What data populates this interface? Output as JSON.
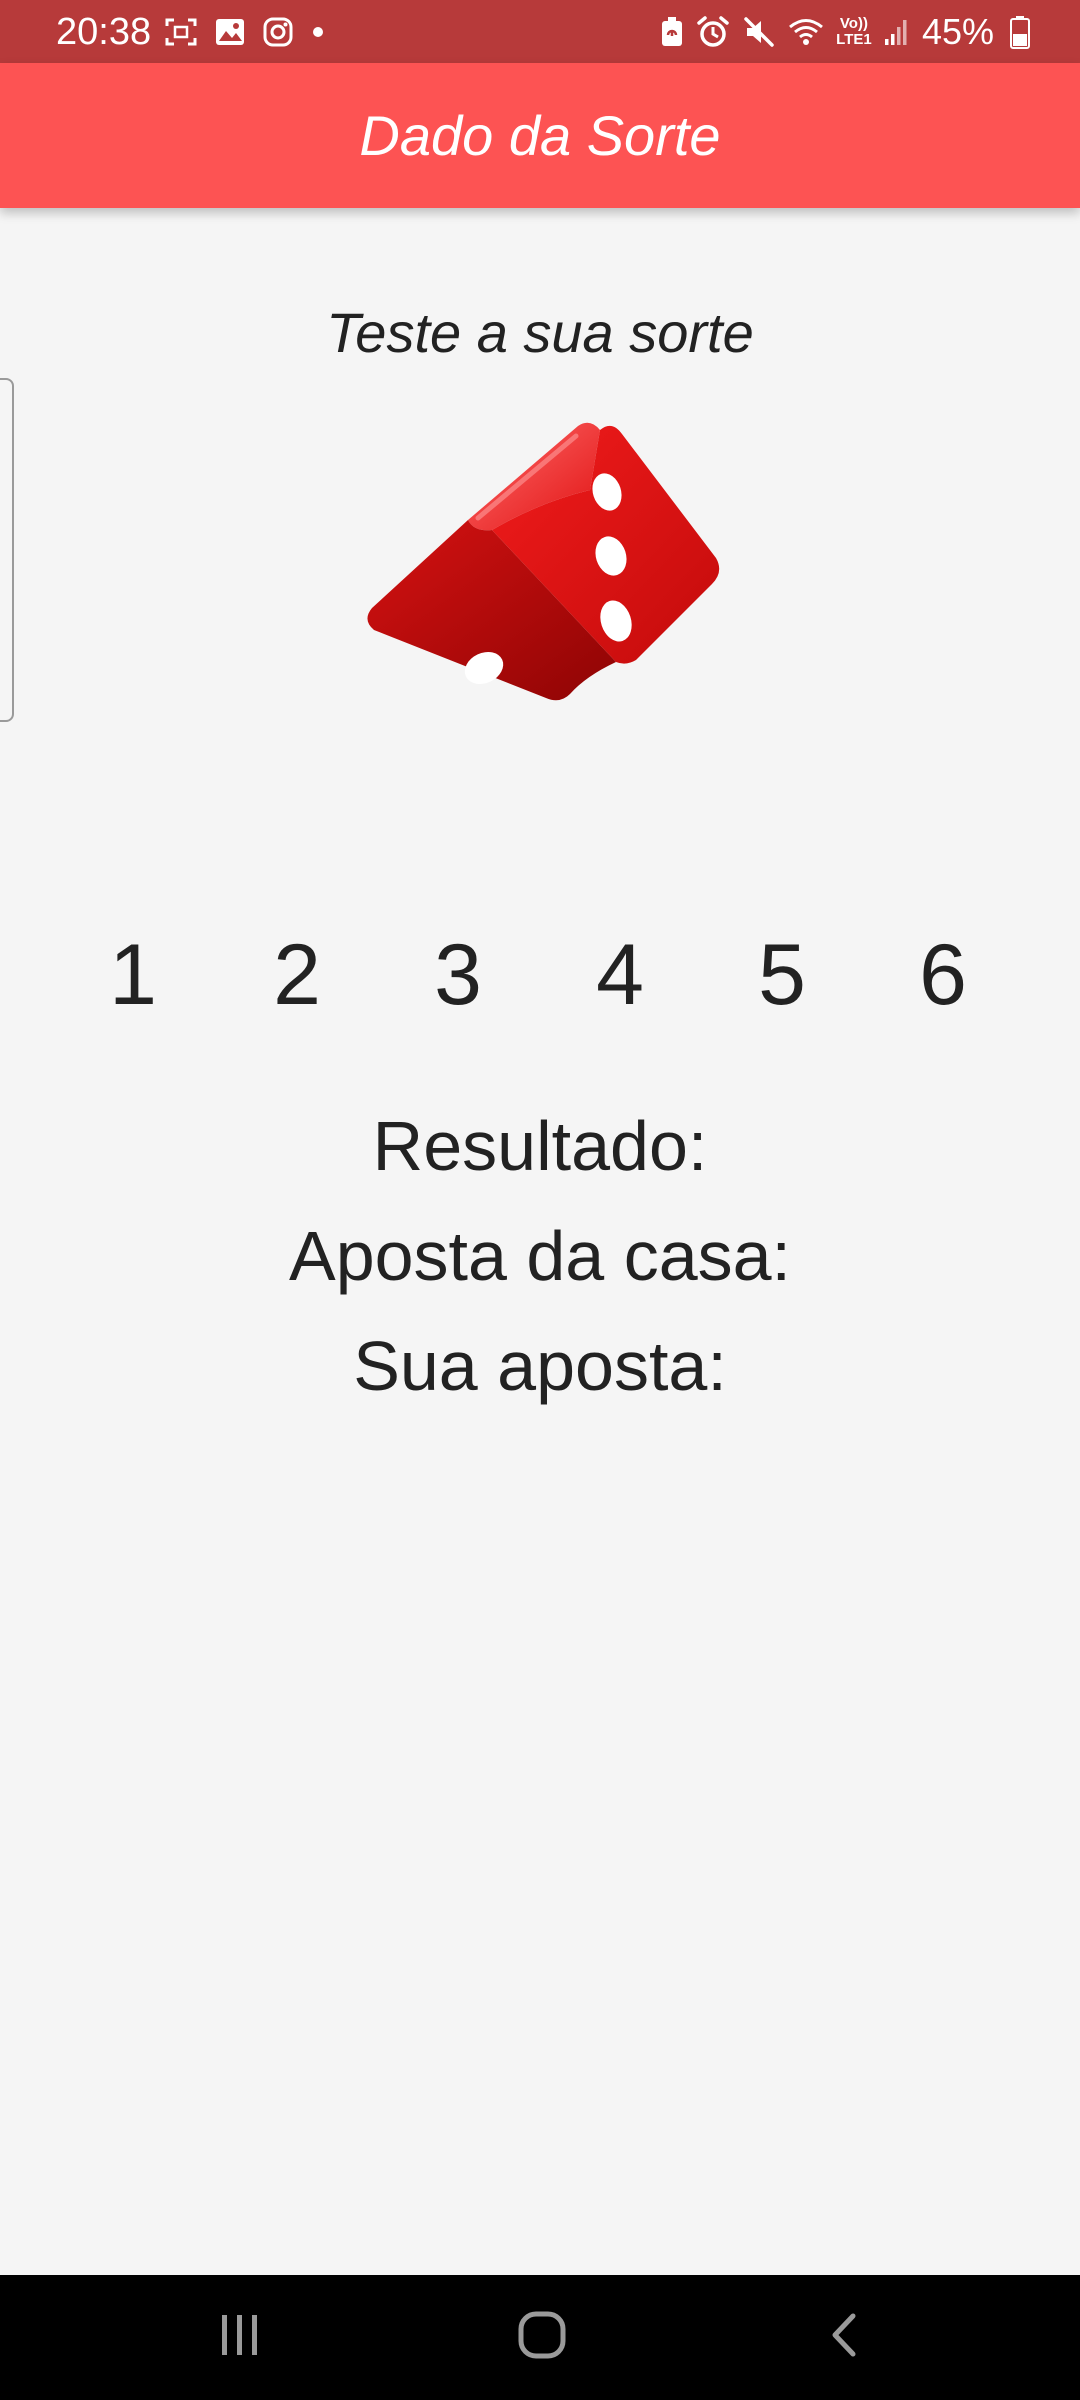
{
  "status_bar": {
    "time": "20:38",
    "battery": "45%",
    "network": "LTE1",
    "volte": "Vo))",
    "left_icons": [
      "screenshot-icon",
      "gallery-icon",
      "instagram-icon",
      "notification-dot-icon"
    ],
    "right_icons": [
      "battery-saver-icon",
      "alarm-icon",
      "mute-icon",
      "wifi-icon",
      "volte-lte-icon",
      "signal-icon",
      "battery-icon"
    ]
  },
  "app_bar": {
    "title": "Dado da Sorte"
  },
  "main": {
    "subtitle": "Teste a sua sorte",
    "dice_icon": "dice-icon",
    "bet_numbers": [
      "1",
      "2",
      "3",
      "4",
      "5",
      "6"
    ],
    "result_label": "Resultado:",
    "house_bet_label": "Aposta da casa:",
    "your_bet_label": "Sua aposta:"
  },
  "nav_bar": {
    "buttons": [
      "recent-apps-icon",
      "home-icon",
      "back-icon"
    ]
  },
  "colors": {
    "status_bar": "#b73a3a",
    "app_bar": "#fd5353",
    "background": "#f5f5f5",
    "text": "#222222",
    "dice_red": "#e81515",
    "nav_bar": "#000000"
  }
}
